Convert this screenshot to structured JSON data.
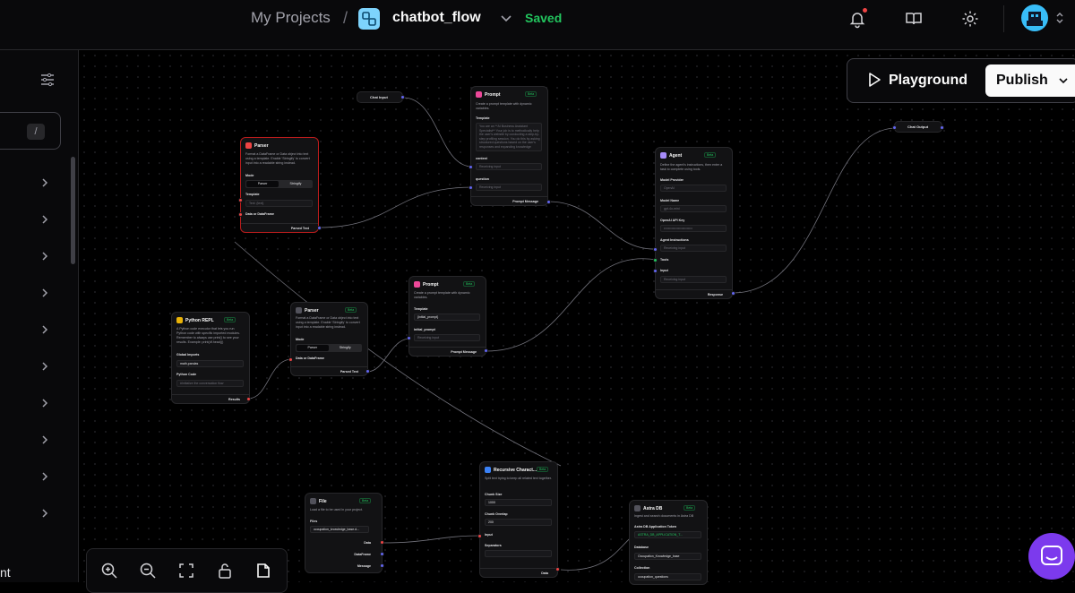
{
  "topbar": {
    "breadcrumb_root": "My Projects",
    "breadcrumb_sep": "/",
    "flow_name": "chatbot_flow",
    "save_status": "Saved",
    "icons": [
      "bell-icon",
      "book-icon",
      "gear-icon",
      "avatar"
    ]
  },
  "actions": {
    "playground": "Playground",
    "publish": "Publish"
  },
  "sidebar": {
    "search_shortcut": "/",
    "bottom_text": "nt"
  },
  "nodes": {
    "chat_input": {
      "title": "Chat Input"
    },
    "chat_output": {
      "title": "Chat Output"
    },
    "prompt1": {
      "title": "Prompt",
      "badge": "Beta",
      "desc": "Create a prompt template with dynamic variables.",
      "template_label": "Template",
      "template_text": "You are an **AI Business Assistant Specialist** Your job is to methodically help the user's website by conducting a step-by-step profiling session. You do this by asking structured questions based on the user's responses and expanding knowledge",
      "context_label": "context",
      "context_ph": "Receiving input",
      "question_label": "question",
      "question_ph": "Receiving input",
      "output": "Prompt Message"
    },
    "parser1": {
      "title": "Parser",
      "desc": "Format a DataFrame or Data object into text using a template. Enable 'Stringify' to convert input into a readable string instead.",
      "mode_label": "Mode",
      "mode_on": "Parser",
      "mode_off": "Stringify",
      "template_label": "Template",
      "template_ph": "Text: {text}",
      "input_label": "Data or DataFrame",
      "output": "Parsed Text"
    },
    "agent": {
      "title": "Agent",
      "badge": "Beta",
      "desc": "Define the agent's instructions, then enter a task to complete using tools.",
      "provider_label": "Model Provider",
      "provider_value": "OpenAI",
      "model_label": "Model Name",
      "model_value": "gpt-4o-mini",
      "key_label": "OpenAI API Key",
      "key_value": "••••••••••••••••••••••••••",
      "instructions_label": "Agent Instructions",
      "instructions_ph": "Receiving input",
      "tools_label": "Tools",
      "input_label": "Input",
      "input_ph": "Receiving input",
      "output": "Response"
    },
    "python": {
      "title": "Python REPL",
      "badge": "Beta",
      "desc": "A Python code executor that lets you run Python code with specific imported modules. Remember to always use print() to see your results. Example: print(df.head())",
      "imports_label": "Global Imports",
      "imports_value": "math,pandas",
      "code_label": "Python Code",
      "code_value": "#Initialize the conversation flow",
      "output": "Results"
    },
    "parser2": {
      "title": "Parser",
      "badge": "Beta",
      "desc": "Format a DataFrame or Data object into text using a template. Enable 'Stringify' to convert input into a readable string instead.",
      "mode_label": "Mode",
      "mode_on": "Parser",
      "mode_off": "Stringify",
      "input_label": "Data or DataFrame",
      "output": "Parsed Text"
    },
    "prompt2": {
      "title": "Prompt",
      "badge": "Beta",
      "desc": "Create a prompt template with dynamic variables.",
      "template_label": "Template",
      "template_value": "{initial_prompt}",
      "var_label": "initial_prompt",
      "var_ph": "Receiving input",
      "output": "Prompt Message"
    },
    "splitter": {
      "title": "Recursive Charact...",
      "badge": "Beta",
      "desc": "Split text trying to keep all related text together.",
      "chunk_size_label": "Chunk Size",
      "chunk_size_value": "1000",
      "overlap_label": "Chunk Overlap",
      "overlap_value": "200",
      "input_label": "Input",
      "separators_label": "Separators",
      "output": "Data"
    },
    "file": {
      "title": "File",
      "badge": "Beta",
      "desc": "Load a file to be used in your project.",
      "files_label": "Files",
      "files_value": "occupation_knowledge_base.d...",
      "out_data": "Data",
      "out_df": "DataFrame",
      "out_msg": "Message"
    },
    "astra": {
      "title": "Astra DB",
      "badge": "Beta",
      "desc": "Ingest and search documents in Astra DB",
      "token_label": "Astra DB Application Token",
      "token_value": "ASTRA_DB_APPLICATION_T...",
      "db_label": "Database",
      "db_value": "Occupation_Knowledge_base",
      "coll_label": "Collection",
      "coll_value": "occupation_questions"
    }
  }
}
